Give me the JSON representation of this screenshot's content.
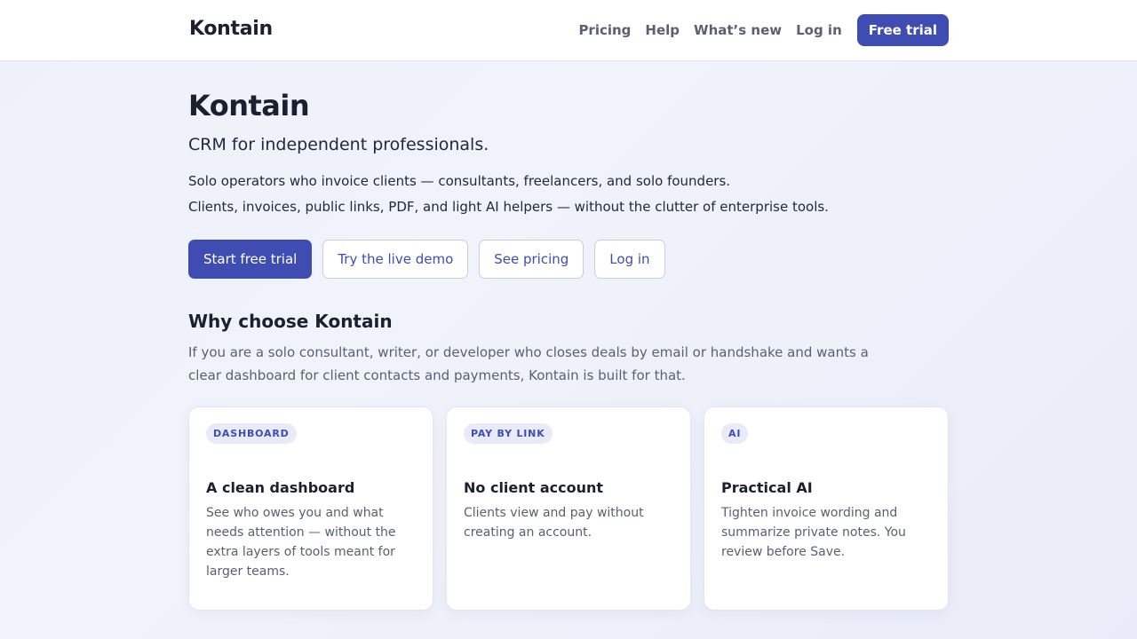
{
  "header": {
    "brand": "Kontain",
    "nav": [
      "Pricing",
      "Help",
      "What’s new",
      "Log in"
    ],
    "cta": "Free trial"
  },
  "hero": {
    "title": "Kontain",
    "subtitle": "CRM for independent professionals.",
    "line1": "Solo operators who invoice clients — consultants, freelancers, and solo founders.",
    "line2": "Clients, invoices, public links, PDF, and light AI helpers — without the clutter of enterprise tools.",
    "buttons": {
      "start": "Start free trial",
      "demo": "Try the live demo",
      "pricing": "See pricing",
      "login": "Log in"
    }
  },
  "why": {
    "title": "Why choose Kontain",
    "text": "If you are a solo consultant, writer, or developer who closes deals by email or handshake and wants a clear dashboard for client contacts and payments, Kontain is built for that.",
    "cards": [
      {
        "badge": "DASHBOARD",
        "title": "A clean dashboard",
        "text": "See who owes you and what needs attention — without the extra layers of tools meant for larger teams."
      },
      {
        "badge": "PAY BY LINK",
        "title": "No client account",
        "text": "Clients view and pay without creating an account."
      },
      {
        "badge": "AI",
        "title": "Practical AI",
        "text": "Tighten invoice wording and summarize private notes. You review before Save."
      }
    ]
  }
}
